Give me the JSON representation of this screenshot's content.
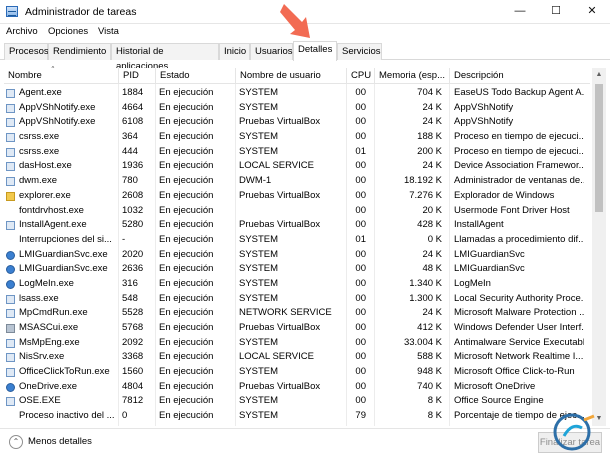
{
  "window": {
    "title": "Administrador de tareas",
    "controls": {
      "minimize": "—",
      "maximize": "☐",
      "close": "✕"
    }
  },
  "menu": [
    "Archivo",
    "Opciones",
    "Vista"
  ],
  "tabs": [
    "Procesos",
    "Rendimiento",
    "Historial de aplicaciones",
    "Inicio",
    "Usuarios",
    "Detalles",
    "Servicios"
  ],
  "active_tab": "Detalles",
  "columns": {
    "name": "Nombre",
    "pid": "PID",
    "estado": "Estado",
    "user": "Nombre de usuario",
    "cpu": "CPU",
    "mem": "Memoria (esp...",
    "desc": "Descripción"
  },
  "rows": [
    {
      "name": "Agent.exe",
      "pid": "1884",
      "estado": "En ejecución",
      "user": "SYSTEM",
      "cpu": "00",
      "mem": "704 K",
      "desc": "EaseUS Todo Backup Agent A...",
      "icon": "app-icon"
    },
    {
      "name": "AppVShNotify.exe",
      "pid": "4664",
      "estado": "En ejecución",
      "user": "SYSTEM",
      "cpu": "00",
      "mem": "24 K",
      "desc": "AppVShNotify",
      "icon": "app-icon"
    },
    {
      "name": "AppVShNotify.exe",
      "pid": "6108",
      "estado": "En ejecución",
      "user": "Pruebas VirtualBox",
      "cpu": "00",
      "mem": "24 K",
      "desc": "AppVShNotify",
      "icon": "app-icon"
    },
    {
      "name": "csrss.exe",
      "pid": "364",
      "estado": "En ejecución",
      "user": "SYSTEM",
      "cpu": "00",
      "mem": "188 K",
      "desc": "Proceso en tiempo de ejecuci...",
      "icon": "app-icon"
    },
    {
      "name": "csrss.exe",
      "pid": "444",
      "estado": "En ejecución",
      "user": "SYSTEM",
      "cpu": "01",
      "mem": "200 K",
      "desc": "Proceso en tiempo de ejecuci...",
      "icon": "app-icon"
    },
    {
      "name": "dasHost.exe",
      "pid": "1936",
      "estado": "En ejecución",
      "user": "LOCAL SERVICE",
      "cpu": "00",
      "mem": "24 K",
      "desc": "Device Association Framewor...",
      "icon": "app-icon"
    },
    {
      "name": "dwm.exe",
      "pid": "780",
      "estado": "En ejecución",
      "user": "DWM-1",
      "cpu": "00",
      "mem": "18.192 K",
      "desc": "Administrador de ventanas de...",
      "icon": "app-icon"
    },
    {
      "name": "explorer.exe",
      "pid": "2608",
      "estado": "En ejecución",
      "user": "Pruebas VirtualBox",
      "cpu": "00",
      "mem": "7.276 K",
      "desc": "Explorador de Windows",
      "icon": "folder-icon"
    },
    {
      "name": "fontdrvhost.exe",
      "pid": "1032",
      "estado": "En ejecución",
      "user": "",
      "cpu": "00",
      "mem": "20 K",
      "desc": "Usermode Font Driver Host",
      "icon": "blank-icon"
    },
    {
      "name": "InstallAgent.exe",
      "pid": "5280",
      "estado": "En ejecución",
      "user": "Pruebas VirtualBox",
      "cpu": "00",
      "mem": "428 K",
      "desc": "InstallAgent",
      "icon": "app-icon"
    },
    {
      "name": "Interrupciones del si...",
      "pid": "-",
      "estado": "En ejecución",
      "user": "SYSTEM",
      "cpu": "01",
      "mem": "0 K",
      "desc": "Llamadas a procedimiento dif...",
      "icon": "blank-icon"
    },
    {
      "name": "LMIGuardianSvc.exe",
      "pid": "2020",
      "estado": "En ejecución",
      "user": "SYSTEM",
      "cpu": "00",
      "mem": "24 K",
      "desc": "LMIGuardianSvc",
      "icon": "blue-icon"
    },
    {
      "name": "LMIGuardianSvc.exe",
      "pid": "2636",
      "estado": "En ejecución",
      "user": "SYSTEM",
      "cpu": "00",
      "mem": "48 K",
      "desc": "LMIGuardianSvc",
      "icon": "blue-icon"
    },
    {
      "name": "LogMeIn.exe",
      "pid": "316",
      "estado": "En ejecución",
      "user": "SYSTEM",
      "cpu": "00",
      "mem": "1.340 K",
      "desc": "LogMeIn",
      "icon": "blue-icon"
    },
    {
      "name": "lsass.exe",
      "pid": "548",
      "estado": "En ejecución",
      "user": "SYSTEM",
      "cpu": "00",
      "mem": "1.300 K",
      "desc": "Local Security Authority Proce...",
      "icon": "app-icon"
    },
    {
      "name": "MpCmdRun.exe",
      "pid": "5528",
      "estado": "En ejecución",
      "user": "NETWORK SERVICE",
      "cpu": "00",
      "mem": "24 K",
      "desc": "Microsoft Malware Protection ...",
      "icon": "app-icon"
    },
    {
      "name": "MSASCui.exe",
      "pid": "5768",
      "estado": "En ejecución",
      "user": "Pruebas VirtualBox",
      "cpu": "00",
      "mem": "412 K",
      "desc": "Windows Defender User Interf...",
      "icon": "gear-icon"
    },
    {
      "name": "MsMpEng.exe",
      "pid": "2092",
      "estado": "En ejecución",
      "user": "SYSTEM",
      "cpu": "00",
      "mem": "33.004 K",
      "desc": "Antimalware Service Executable",
      "icon": "app-icon"
    },
    {
      "name": "NisSrv.exe",
      "pid": "3368",
      "estado": "En ejecución",
      "user": "LOCAL SERVICE",
      "cpu": "00",
      "mem": "588 K",
      "desc": "Microsoft Network Realtime I...",
      "icon": "app-icon"
    },
    {
      "name": "OfficeClickToRun.exe",
      "pid": "1560",
      "estado": "En ejecución",
      "user": "SYSTEM",
      "cpu": "00",
      "mem": "948 K",
      "desc": "Microsoft Office Click-to-Run",
      "icon": "app-icon"
    },
    {
      "name": "OneDrive.exe",
      "pid": "4804",
      "estado": "En ejecución",
      "user": "Pruebas VirtualBox",
      "cpu": "00",
      "mem": "740 K",
      "desc": "Microsoft OneDrive",
      "icon": "blue-icon"
    },
    {
      "name": "OSE.EXE",
      "pid": "7812",
      "estado": "En ejecución",
      "user": "SYSTEM",
      "cpu": "00",
      "mem": "8 K",
      "desc": "Office Source Engine",
      "icon": "app-icon"
    },
    {
      "name": "Proceso inactivo del ...",
      "pid": "0",
      "estado": "En ejecución",
      "user": "SYSTEM",
      "cpu": "79",
      "mem": "8 K",
      "desc": "Porcentaje de tiempo de ejec...",
      "icon": "blank-icon"
    }
  ],
  "footer": {
    "less_details": "Menos detalles",
    "end_task": "Finalizar tarea",
    "collapse_icon": "chevron-up-icon"
  },
  "accent_color": "#f26b53"
}
